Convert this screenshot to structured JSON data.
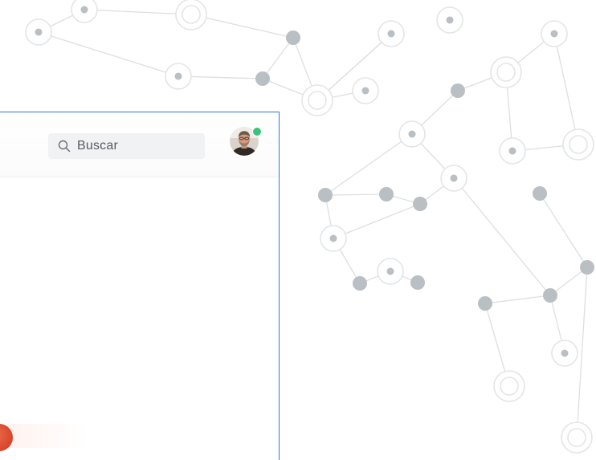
{
  "search": {
    "placeholder": "Buscar"
  },
  "user": {
    "status": "online"
  },
  "colors": {
    "panel_border": "#2f7bd6",
    "status_online": "#3cc27a",
    "node_fill": "#b9bfc2",
    "node_ring": "#e3e5e6",
    "edge": "#d9dcde",
    "fab": "#d8452a"
  },
  "icons": {
    "search": "search-icon",
    "avatar": "avatar",
    "status": "online-status-dot"
  }
}
